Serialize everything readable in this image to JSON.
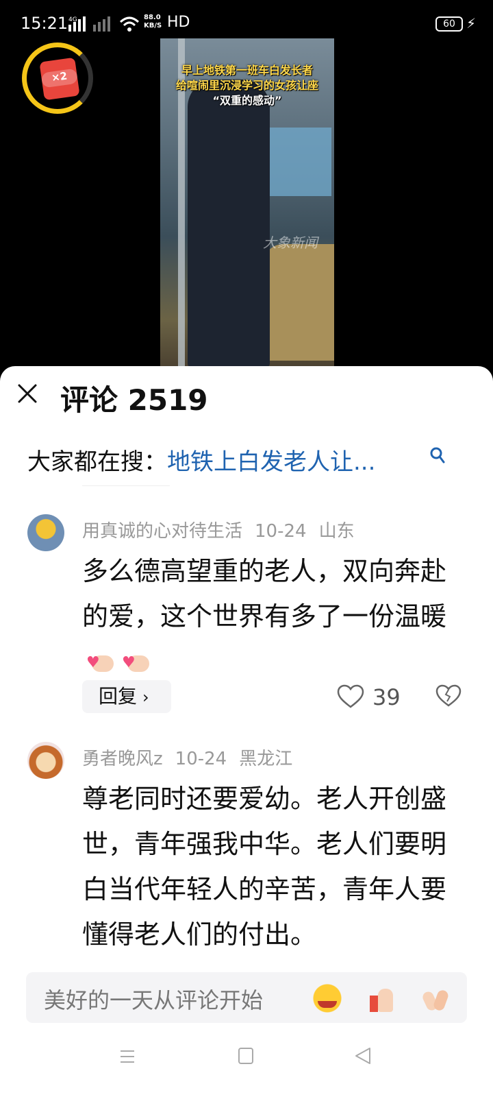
{
  "status_bar": {
    "time": "15:21",
    "network_type": "4G",
    "net_speed_value": "88.0",
    "net_speed_unit": "KB/S",
    "hd_label": "HD",
    "battery": "60"
  },
  "video": {
    "caption_line1": "早上地铁第一班车白发长者",
    "caption_line2": "给喧闹里沉浸学习的女孩让座",
    "caption_line3": "“双重的感动”",
    "watermark": "大象新闻",
    "reward_badge": "×2"
  },
  "comments_panel": {
    "title": "评论 2519",
    "search_prefix": "大家都在搜：",
    "search_link": "地铁上白发老人让..."
  },
  "comments": [
    {
      "username": "用真诚的心对待生活",
      "date": "10-24",
      "location": "山东",
      "text": "多么德高望重的老人，双向奔赴的爱，这个世界有多了一份温暖",
      "reply_label": "回复",
      "likes": "39"
    },
    {
      "username": "勇者晚风z",
      "date": "10-24",
      "location": "黑龙江",
      "text": "尊老同时还要爱幼。老人开创盛世，青年强我中华。老人们要明白当代年轻人的辛苦，青年人要懂得老人们的付出。"
    }
  ],
  "input_bar": {
    "placeholder": "美好的一天从评论开始"
  },
  "icons": {
    "close": "close-icon",
    "search": "search-icon",
    "like": "heart-outline-icon",
    "dislike": "broken-heart-icon",
    "reply_chevron": "chevron-right-icon"
  },
  "colors": {
    "link": "#1f63b0",
    "meta_text": "#999999",
    "badge_ring": "#f5c518",
    "red_packet": "#e8453c"
  }
}
